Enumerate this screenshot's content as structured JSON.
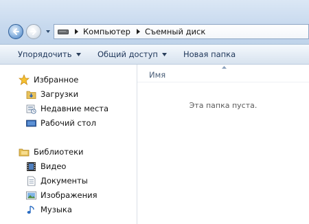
{
  "navigation": {
    "back_icon": "back-arrow-icon",
    "forward_icon": "forward-arrow-icon",
    "history_icon": "chevron-down-icon"
  },
  "address": {
    "drive_icon": "removable-drive-icon",
    "crumbs": [
      "Компьютер",
      "Съемный диск"
    ]
  },
  "commands": {
    "organize": "Упорядочить",
    "share": "Общий доступ",
    "new_folder": "Новая папка"
  },
  "sidebar": {
    "favorites": {
      "label": "Избранное",
      "icon": "star-icon",
      "items": [
        {
          "label": "Загрузки",
          "icon": "downloads-folder-icon"
        },
        {
          "label": "Недавние места",
          "icon": "recent-places-icon"
        },
        {
          "label": "Рабочий стол",
          "icon": "desktop-icon"
        }
      ]
    },
    "libraries": {
      "label": "Библиотеки",
      "icon": "libraries-icon",
      "items": [
        {
          "label": "Видео",
          "icon": "video-icon"
        },
        {
          "label": "Документы",
          "icon": "documents-icon"
        },
        {
          "label": "Изображения",
          "icon": "pictures-icon"
        },
        {
          "label": "Музыка",
          "icon": "music-icon"
        }
      ]
    }
  },
  "main": {
    "column_name": "Имя",
    "empty_message": "Эта папка пуста."
  },
  "colors": {
    "accent": "#3f78bd",
    "command_text": "#1d3558"
  }
}
